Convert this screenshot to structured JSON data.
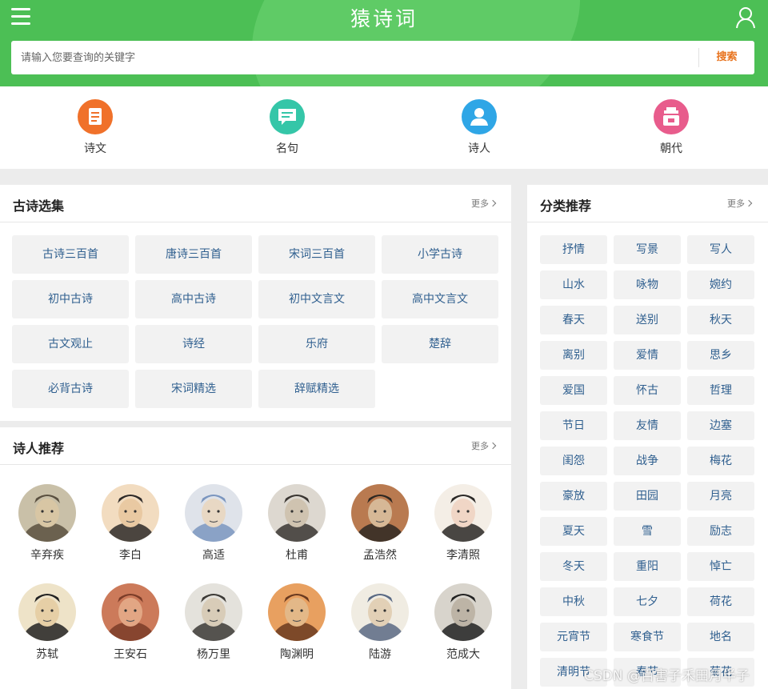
{
  "header": {
    "title": "猿诗词",
    "menu_icon": "hamburger-menu-icon",
    "user_icon": "user-icon",
    "search_placeholder": "请输入您要查询的关键字",
    "search_button": "搜索",
    "bg_color": "#4cbf55"
  },
  "categories": [
    {
      "label": "诗文",
      "icon": "document-icon",
      "color": "#f0712a"
    },
    {
      "label": "名句",
      "icon": "chat-icon",
      "color": "#35c6a8"
    },
    {
      "label": "诗人",
      "icon": "person-icon",
      "color": "#2fa6e6"
    },
    {
      "label": "朝代",
      "icon": "building-icon",
      "color": "#e85c8c"
    }
  ],
  "collections": {
    "title": "古诗选集",
    "more": "更多",
    "items": [
      "古诗三百首",
      "唐诗三百首",
      "宋词三百首",
      "小学古诗",
      "初中古诗",
      "高中古诗",
      "初中文言文",
      "高中文言文",
      "古文观止",
      "诗经",
      "乐府",
      "楚辞",
      "必背古诗",
      "宋词精选",
      "辞赋精选"
    ]
  },
  "poets": {
    "title": "诗人推荐",
    "more": "更多",
    "items": [
      "辛弃疾",
      "李白",
      "高适",
      "杜甫",
      "孟浩然",
      "李清照",
      "苏轼",
      "王安石",
      "杨万里",
      "陶渊明",
      "陆游",
      "范成大"
    ]
  },
  "tags": {
    "title": "分类推荐",
    "more": "更多",
    "items": [
      "抒情",
      "写景",
      "写人",
      "山水",
      "咏物",
      "婉约",
      "春天",
      "送别",
      "秋天",
      "离别",
      "爱情",
      "思乡",
      "爱国",
      "怀古",
      "哲理",
      "节日",
      "友情",
      "边塞",
      "闺怨",
      "战争",
      "梅花",
      "豪放",
      "田园",
      "月亮",
      "夏天",
      "雪",
      "励志",
      "冬天",
      "重阳",
      "悼亡",
      "中秋",
      "七夕",
      "荷花",
      "元宵节",
      "寒食节",
      "地名",
      "清明节",
      "春节",
      "菊花"
    ]
  },
  "watermark": "CSDN @百害子禾田月半子"
}
